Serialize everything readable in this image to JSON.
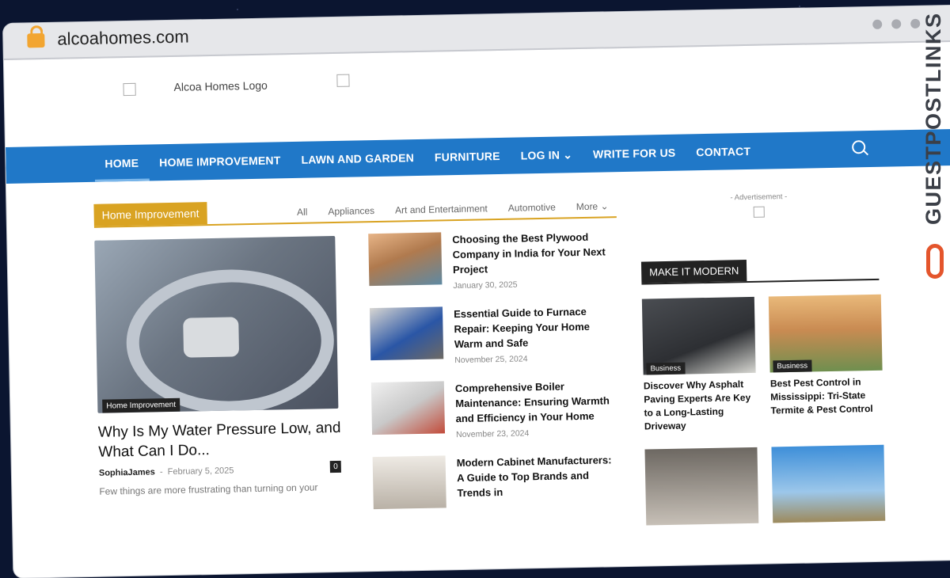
{
  "browser": {
    "url": "alcoahomes.com"
  },
  "header": {
    "logo_alt": "Alcoa Homes Logo"
  },
  "nav": {
    "items": [
      "HOME",
      "HOME IMPROVEMENT",
      "LAWN AND GARDEN",
      "FURNITURE",
      "LOG IN",
      "WRITE FOR US",
      "CONTACT"
    ]
  },
  "section": {
    "label": "Home Improvement",
    "tabs": [
      "All",
      "Appliances",
      "Art and Entertainment",
      "Automotive",
      "More"
    ]
  },
  "featured": {
    "tag": "Home Improvement",
    "title": "Why Is My Water Pressure Low, and What Can I Do...",
    "author": "SophiaJames",
    "date": "February 5, 2025",
    "comments": "0",
    "excerpt": "Few things are more frustrating than turning on your"
  },
  "list": [
    {
      "title": "Choosing the Best Plywood Company in India for Your Next Project",
      "date": "January 30, 2025"
    },
    {
      "title": "Essential Guide to Furnace Repair: Keeping Your Home Warm and Safe",
      "date": "November 25, 2024"
    },
    {
      "title": "Comprehensive Boiler Maintenance: Ensuring Warmth and Efficiency in Your Home",
      "date": "November 23, 2024"
    },
    {
      "title": "Modern Cabinet Manufacturers: A Guide to Top Brands and Trends in",
      "date": ""
    }
  ],
  "sidebar": {
    "ad_label": "- Advertisement -",
    "section_label": "MAKE IT MODERN",
    "posts": [
      {
        "tag": "Business",
        "title": "Discover Why Asphalt Paving Experts Are Key to a Long-Lasting Driveway"
      },
      {
        "tag": "Business",
        "title": "Best Pest Control in Mississippi: Tri-State Termite & Pest Control"
      },
      {
        "tag": "",
        "title": ""
      },
      {
        "tag": "",
        "title": ""
      }
    ]
  },
  "badge": {
    "text": "GUESTPOSTLINKS"
  }
}
